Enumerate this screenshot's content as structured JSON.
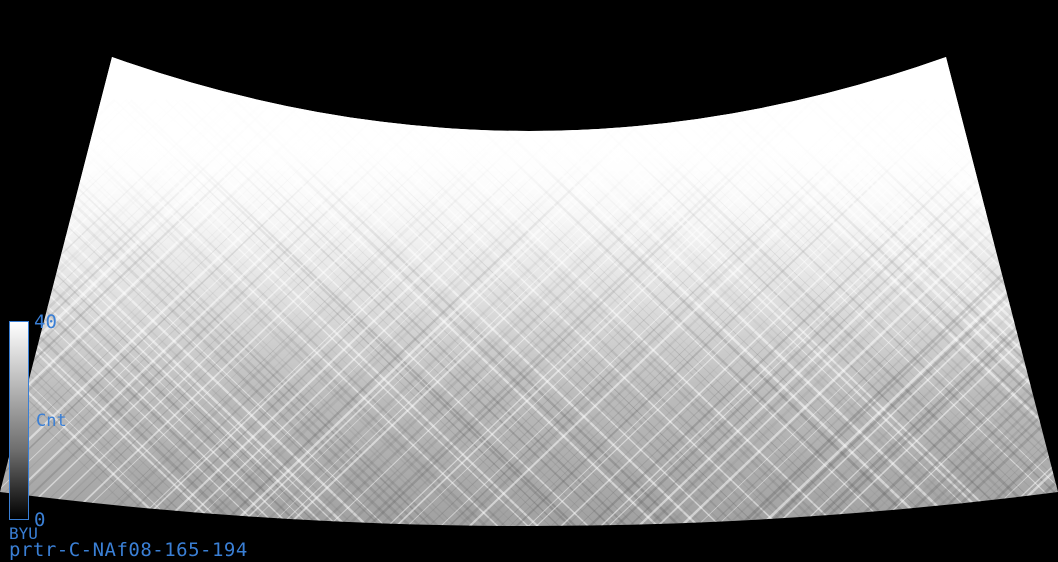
{
  "colorbar": {
    "max_label": "40",
    "mid_label": "Cnt",
    "min_label": "0",
    "max_value": 40,
    "min_value": 0
  },
  "footer": {
    "source_label": "BYU",
    "product_name": "prtr-C-NAf08-165-194"
  },
  "colors": {
    "background": "#000000",
    "label_color": "#3a7fd5",
    "swath_light": "#ffffff",
    "swath_dark": "#555555"
  }
}
